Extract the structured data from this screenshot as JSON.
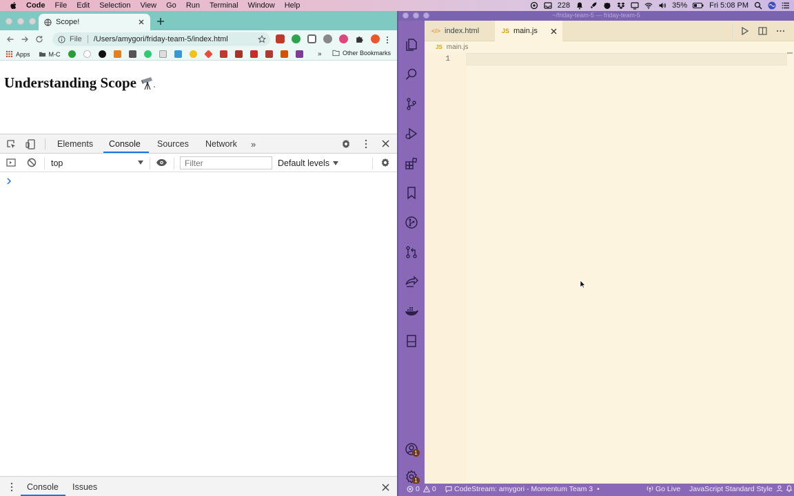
{
  "menubar": {
    "app": "Code",
    "items": [
      "File",
      "Edit",
      "Selection",
      "View",
      "Go",
      "Run",
      "Terminal",
      "Window",
      "Help"
    ],
    "count_label": "228",
    "battery": "35%",
    "clock": "Fri 5:08 PM"
  },
  "chrome": {
    "tab_title": "Scope!",
    "omnibox_scheme": "File",
    "url": "/Users/amygori/friday-team-5/index.html",
    "bookmarks": {
      "apps": "Apps",
      "mc": "M-C",
      "more": "»",
      "other": "Other Bookmarks"
    },
    "page_heading": "Understanding Scope"
  },
  "devtools": {
    "tabs": [
      "Elements",
      "Console",
      "Sources",
      "Network"
    ],
    "more": "»",
    "context": "top",
    "filter_placeholder": "Filter",
    "levels": "Default levels",
    "drawer_tabs": [
      "Console",
      "Issues"
    ]
  },
  "vscode": {
    "window_title": "~/friday-team-5 — friday-team-5",
    "tabs": [
      {
        "lang": "</>",
        "label": "index.html"
      },
      {
        "lang": "JS",
        "label": "main.js"
      }
    ],
    "breadcrumb_lang": "JS",
    "breadcrumb": "main.js",
    "line_number": "1",
    "badges": {
      "accounts": "1",
      "settings": "1"
    },
    "status": {
      "errors": "0",
      "warnings": "0",
      "codestream": "CodeStream: amygori - Momentum Team 3",
      "codestream_dot": "•",
      "golive": "Go Live",
      "style": "JavaScript Standard Style"
    }
  },
  "colors": {
    "activity_bar": "#8a68b8",
    "chrome_tabstrip": "#7fc9c3",
    "editor_bg": "#fdf4df",
    "devtools_accent": "#1a73e8"
  }
}
